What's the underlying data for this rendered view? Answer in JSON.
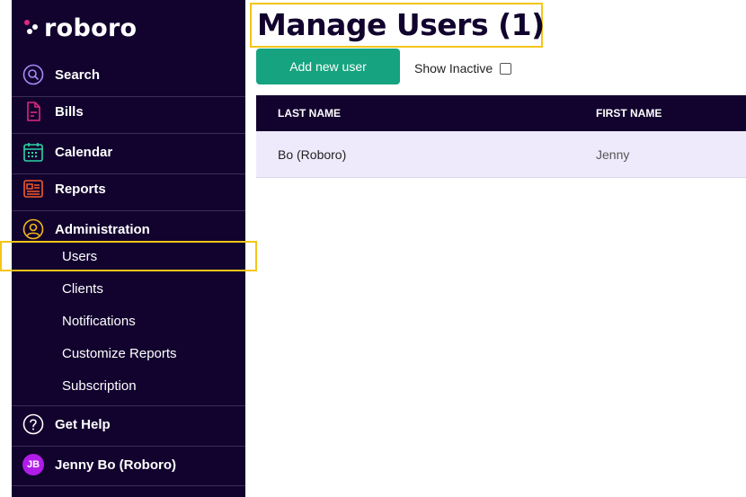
{
  "app": {
    "logo_text": "roboro"
  },
  "sidebar": {
    "items": [
      {
        "label": "Search",
        "icon": "search-icon"
      },
      {
        "label": "Bills",
        "icon": "document-icon"
      },
      {
        "label": "Calendar",
        "icon": "calendar-icon"
      },
      {
        "label": "Reports",
        "icon": "newspaper-icon"
      },
      {
        "label": "Administration",
        "icon": "user-circle-icon"
      }
    ],
    "admin_subitems": [
      "Users",
      "Clients",
      "Notifications",
      "Customize Reports",
      "Subscription"
    ],
    "help": {
      "label": "Get Help",
      "icon": "question-icon"
    },
    "user": {
      "initials": "JB",
      "name": "Jenny Bo (Roboro)"
    }
  },
  "main": {
    "title": "Manage Users (1)",
    "add_button": "Add new user",
    "show_inactive_label": "Show Inactive",
    "table": {
      "columns": [
        "LAST NAME",
        "FIRST NAME"
      ],
      "rows": [
        [
          "Bo (Roboro)",
          "Jenny"
        ]
      ]
    }
  },
  "colors": {
    "sidebar_bg": "#12032e",
    "accent_green": "#16a37f",
    "highlight_yellow": "#f5c518",
    "row_bg": "#efeafb",
    "avatar_bg": "#b01ce8"
  }
}
